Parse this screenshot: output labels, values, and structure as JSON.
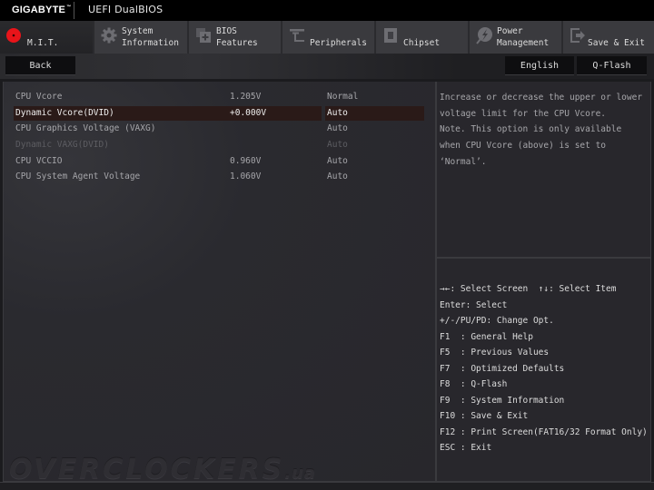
{
  "brand": {
    "logo": "GIGABYTE",
    "trademark": "™",
    "title": "UEFI DualBIOS"
  },
  "tabs": [
    {
      "id": "mit",
      "line1": "",
      "line2": "M.I.T.",
      "icon": "mit-red-dot-icon",
      "active": true
    },
    {
      "id": "system-information",
      "line1": "System",
      "line2": "Information",
      "icon": "gear-icon",
      "active": false
    },
    {
      "id": "bios-features",
      "line1": "BIOS",
      "line2": "Features",
      "icon": "bios-chip-icon",
      "active": false
    },
    {
      "id": "peripherals",
      "line1": "",
      "line2": "Peripherals",
      "icon": "plug-icon",
      "active": false
    },
    {
      "id": "chipset",
      "line1": "",
      "line2": "Chipset",
      "icon": "chipset-icon",
      "active": false
    },
    {
      "id": "power-management",
      "line1": "Power",
      "line2": "Management",
      "icon": "power-bolt-icon",
      "active": false
    },
    {
      "id": "save-exit",
      "line1": "",
      "line2": "Save & Exit",
      "icon": "exit-arrow-icon",
      "active": false
    }
  ],
  "toolbar": {
    "back_label": "Back",
    "language_label": "English",
    "qflash_label": "Q-Flash"
  },
  "settings": [
    {
      "name": "CPU Vcore",
      "value": "1.205V",
      "option": "Normal",
      "state": "normal"
    },
    {
      "name": "Dynamic Vcore(DVID)",
      "value": "+0.000V",
      "option": "Auto",
      "state": "selected"
    },
    {
      "name": "CPU Graphics Voltage (VAXG)",
      "value": "",
      "option": "Auto",
      "state": "normal"
    },
    {
      "name": "Dynamic VAXG(DVID)",
      "value": "",
      "option": "Auto",
      "state": "disabled"
    },
    {
      "name": "CPU VCCIO",
      "value": "0.960V",
      "option": "Auto",
      "state": "normal"
    },
    {
      "name": "CPU System Agent Voltage",
      "value": "1.060V",
      "option": "Auto",
      "state": "normal"
    }
  ],
  "help": {
    "lines": [
      "Increase or decrease the upper or lower",
      "voltage limit for the CPU Vcore.",
      "Note. This option is only available",
      "when CPU Vcore (above) is set to",
      "‘Normal’."
    ]
  },
  "keys": [
    "→←: Select Screen  ↑↓: Select Item",
    "Enter: Select",
    "+/-/PU/PD: Change Opt.",
    "F1  : General Help",
    "F5  : Previous Values",
    "F7  : Optimized Defaults",
    "F8  : Q-Flash",
    "F9  : System Information",
    "F10 : Save & Exit",
    "F12 : Print Screen(FAT16/32 Format Only)",
    "ESC : Exit"
  ],
  "watermark": {
    "main": "OVERCLOCKERS",
    "suffix": ".ua"
  },
  "colors": {
    "accent_red": "#e8141a",
    "selected_row_bg": "#2a1a18",
    "panel_bg": "#28272c"
  }
}
